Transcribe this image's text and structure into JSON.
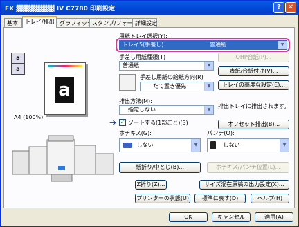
{
  "window": {
    "title": "FX ▓▓▓▓▓▓▓▓ IV C7780 印刷設定",
    "help_glyph": "?",
    "close_glyph": "✕"
  },
  "tabs": [
    {
      "label": "基本"
    },
    {
      "label": "トレイ/排出"
    },
    {
      "label": "グラフィックス"
    },
    {
      "label": "スタンプ/フォーム"
    },
    {
      "label": "詳細設定"
    }
  ],
  "preview": {
    "paper_label": "A4 (100%)",
    "page_letter": "a"
  },
  "paper_tray": {
    "label": "用紙トレイ選択(Y):",
    "selected_value": "トレイ5(手差し)",
    "selected_type": "普通紙"
  },
  "bypass": {
    "paper_type_label": "手差し用紙種類(T)",
    "paper_type_value": "普通紙",
    "ohp_button": "OHP合紙(P)...",
    "orientation_label": "手差し用紙の給紙方向(R)",
    "orientation_value": "たて置き優先",
    "cover_button": "表紙/合紙付け(V)...",
    "tray_advanced_button": "トレイの高度な設定(E)..."
  },
  "output": {
    "method_label": "排出方法(M):",
    "method_value": "指定しない",
    "output_tray_text": "排出トレイに排出されます。",
    "offset_button": "オフセット排出(B)...",
    "sort_label": "ソートする(1部ごと)(S)",
    "sort_checked": true
  },
  "stapler": {
    "label": "ホチキス(G):",
    "value": "しない"
  },
  "punch": {
    "label": "パンチ(O):",
    "value": "しない"
  },
  "buttons": {
    "fold": "紙折り/中とじ(B)...",
    "staple_position": "ホチキス/パンチ位置(L)...",
    "z_fold": "Z折り(Z)...",
    "mixed_size": "サイズ混在原稿の出力設定(X)...",
    "printer_status": "プリンターの状態(U)",
    "restore_default": "標準に戻す(D)",
    "help": "ヘルプ(H)",
    "ok": "OK",
    "cancel": "キャンセル",
    "apply": "適用(A)"
  },
  "colors": {
    "titlebar": "#0046d6",
    "highlight_ring": "#d6399a",
    "selection": "#316ac5",
    "dialog_bg": "#ece9d8"
  }
}
